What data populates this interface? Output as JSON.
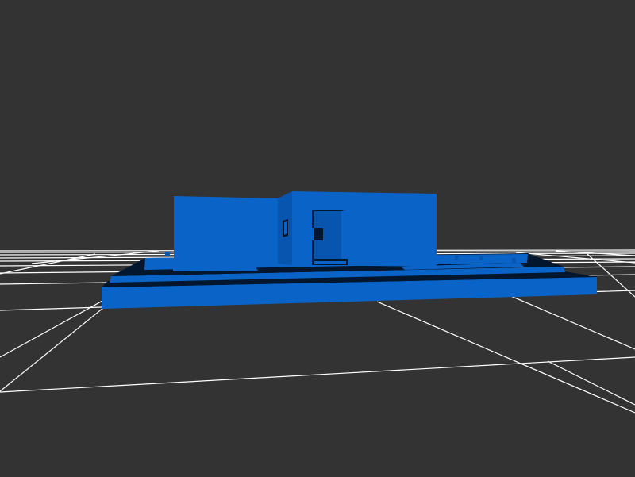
{
  "viewer": {
    "background_color": "#333333",
    "grid_color": "#ffffff",
    "model_color": "#0a64c8",
    "model_shade_color": "#0855b0",
    "model_dark_color": "#02162e",
    "mode": "3d-model-preview"
  }
}
